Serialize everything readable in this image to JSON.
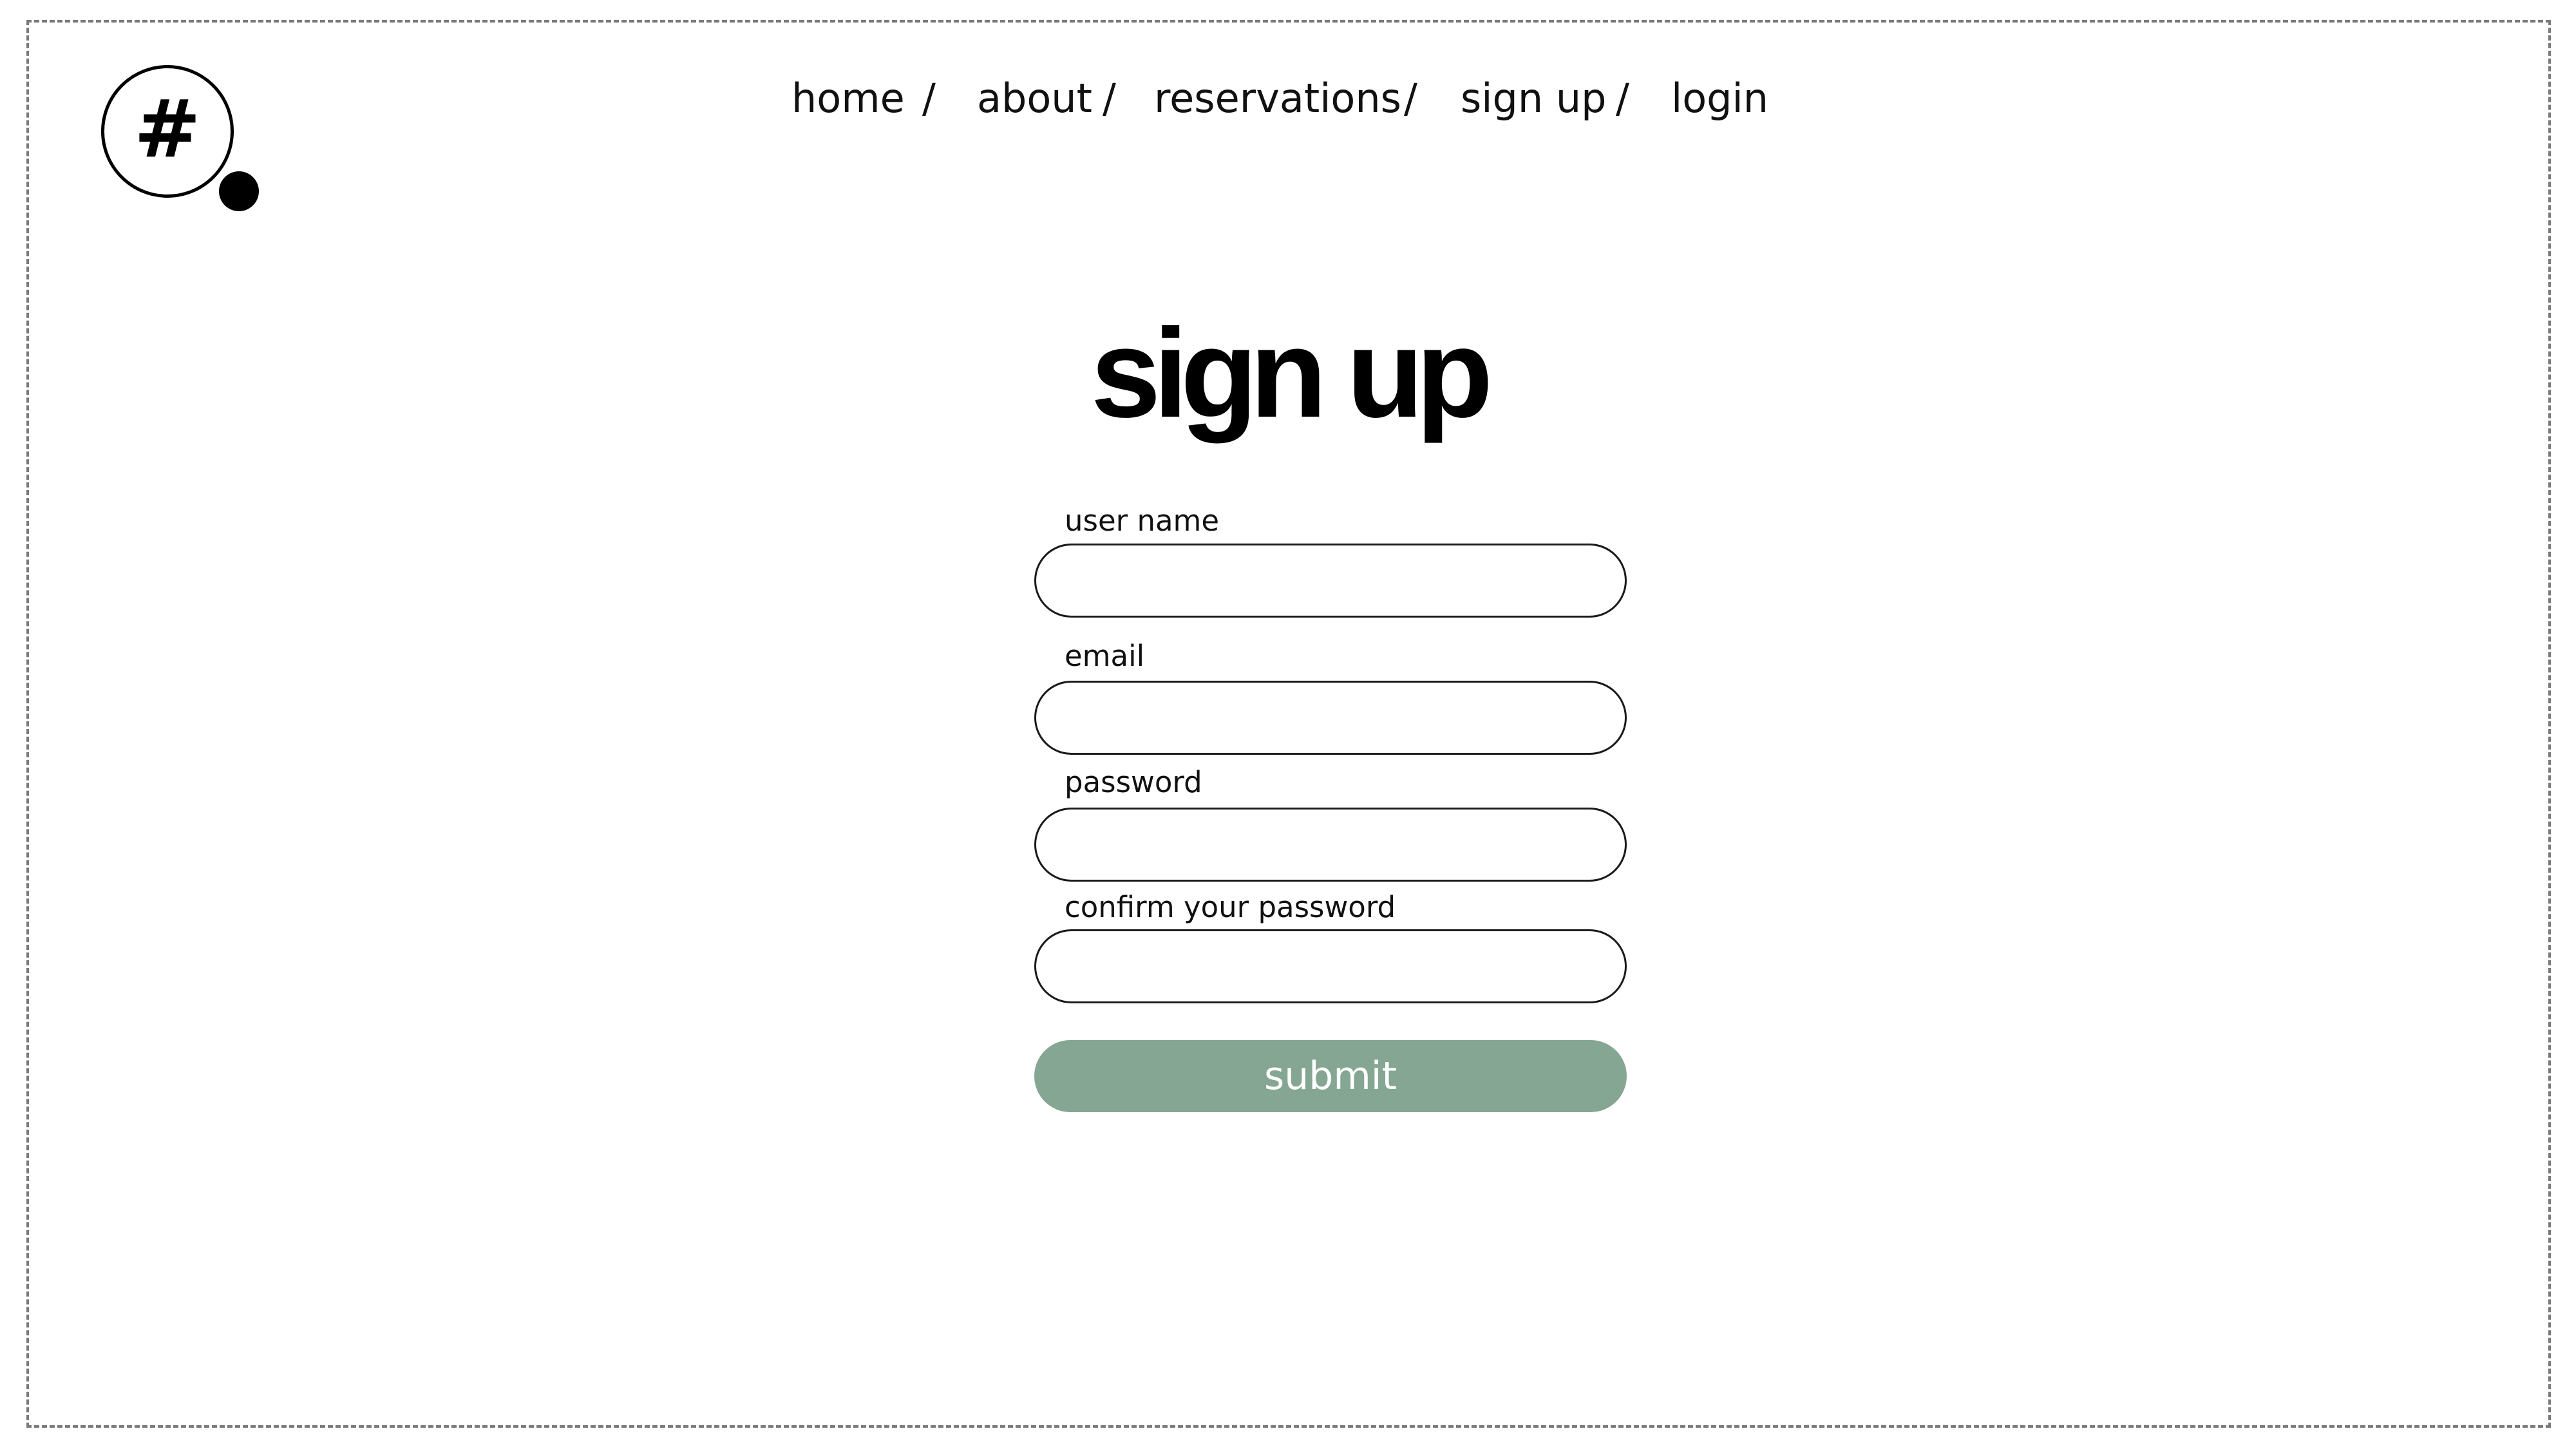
{
  "logo": {
    "glyph": "#",
    "icon": "hash-logo-icon"
  },
  "nav": {
    "items": [
      {
        "label": "home"
      },
      {
        "label": "about"
      },
      {
        "label": "reservations"
      },
      {
        "label": "sign up"
      },
      {
        "label": "login"
      }
    ],
    "separator": "/"
  },
  "page": {
    "title": "sign up"
  },
  "form": {
    "fields": [
      {
        "label": "user name",
        "value": "",
        "placeholder": ""
      },
      {
        "label": "email",
        "value": "",
        "placeholder": ""
      },
      {
        "label": "password",
        "value": "",
        "placeholder": ""
      },
      {
        "label": "confirm your password",
        "value": "",
        "placeholder": ""
      }
    ],
    "submit_label": "submit"
  },
  "colors": {
    "submit_bg": "#85a692",
    "submit_text": "#ffffff",
    "border": "#1a1a1a",
    "frame": "#7a7a7a"
  }
}
